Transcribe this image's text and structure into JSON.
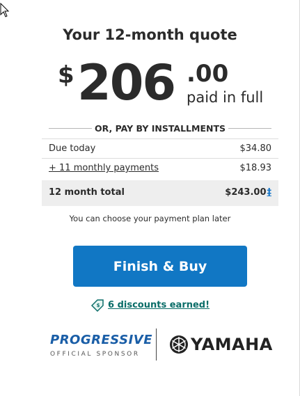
{
  "quote": {
    "title": "Your 12-month quote",
    "currency_symbol": "$",
    "price_whole": "206",
    "price_cents": ".00",
    "paid_label": "paid in full"
  },
  "installments": {
    "header": "OR, PAY BY INSTALLMENTS",
    "due_today_label": "Due today",
    "due_today_value": "$34.80",
    "monthly_label": "+ 11 monthly payments",
    "monthly_value": "$18.93",
    "total_label": "12 month total",
    "total_value": "$243.00",
    "total_footnote_mark": "‡",
    "note": "You can choose your payment plan later"
  },
  "actions": {
    "finish_label": "Finish & Buy",
    "discounts_label": "6 discounts earned!"
  },
  "sponsor": {
    "progressive_word": "PROGRESSIVE",
    "progressive_sub": "OFFICIAL SPONSOR",
    "yamaha_word": "YAMAHA"
  },
  "colors": {
    "button": "#1177c4",
    "discount_link": "#0a6d68",
    "progressive_blue": "#1a5ea7",
    "footnote_blue": "#1877c9"
  },
  "icons": {
    "cursor": "mouse-pointer-icon",
    "discount": "discount-tag-icon",
    "yamaha": "yamaha-tuning-fork-icon"
  }
}
